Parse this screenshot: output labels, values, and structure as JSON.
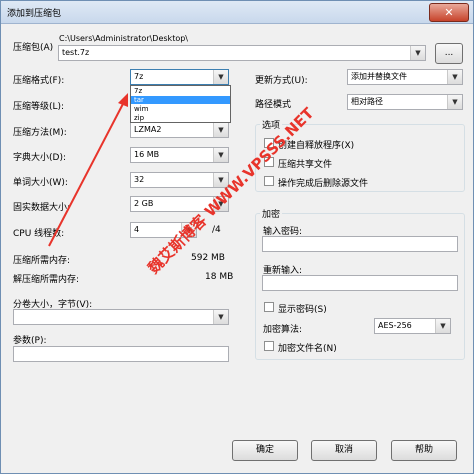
{
  "window": {
    "title": "添加到压缩包",
    "close": "✕"
  },
  "archive": {
    "label": "压缩包(A)",
    "path": "C:\\Users\\Administrator\\Desktop\\",
    "filename": "test.7z",
    "browse": "..."
  },
  "left": {
    "format": {
      "label": "压缩格式(F):",
      "value": "7z",
      "options": [
        "7z",
        "tar",
        "wim",
        "zip"
      ],
      "selected_index": 1
    },
    "level": {
      "label": "压缩等级(L):"
    },
    "method": {
      "label": "压缩方法(M):",
      "value": "LZMA2"
    },
    "dict": {
      "label": "字典大小(D):",
      "value": "16 MB"
    },
    "word": {
      "label": "单词大小(W):",
      "value": "32"
    },
    "solid": {
      "label": "固实数据大小:",
      "value": "2 GB"
    },
    "threads": {
      "label": "CPU 线程数:",
      "value": "4",
      "suffix": "/4"
    },
    "mem_comp": {
      "label": "压缩所需内存:",
      "value": "592 MB"
    },
    "mem_decomp": {
      "label": "解压缩所需内存:",
      "value": "18 MB"
    },
    "split": {
      "label": "分卷大小，字节(V):",
      "value": ""
    },
    "params": {
      "label": "参数(P):",
      "value": ""
    }
  },
  "right": {
    "update": {
      "label": "更新方式(U):",
      "value": "添加并替换文件"
    },
    "path_mode": {
      "label": "路径模式",
      "value": "相对路径"
    },
    "options": {
      "title": "选项",
      "sfx": "创建自释放程序(X)",
      "shared": "压缩共享文件",
      "delete": "操作完成后删除源文件"
    },
    "encryption": {
      "title": "加密",
      "enter_pw": "输入密码:",
      "reenter_pw": "重新输入:",
      "show_pw": "显示密码(S)",
      "method_label": "加密算法:",
      "method_value": "AES-256",
      "encrypt_names": "加密文件名(N)"
    }
  },
  "buttons": {
    "ok": "确定",
    "cancel": "取消",
    "help": "帮助"
  },
  "watermark": "魏艾斯博客 WWW.VPSSS.NET",
  "colors": {
    "accent": "#3399ff",
    "watermark": "#e8342b",
    "titlebar": "#c8d8ec"
  }
}
